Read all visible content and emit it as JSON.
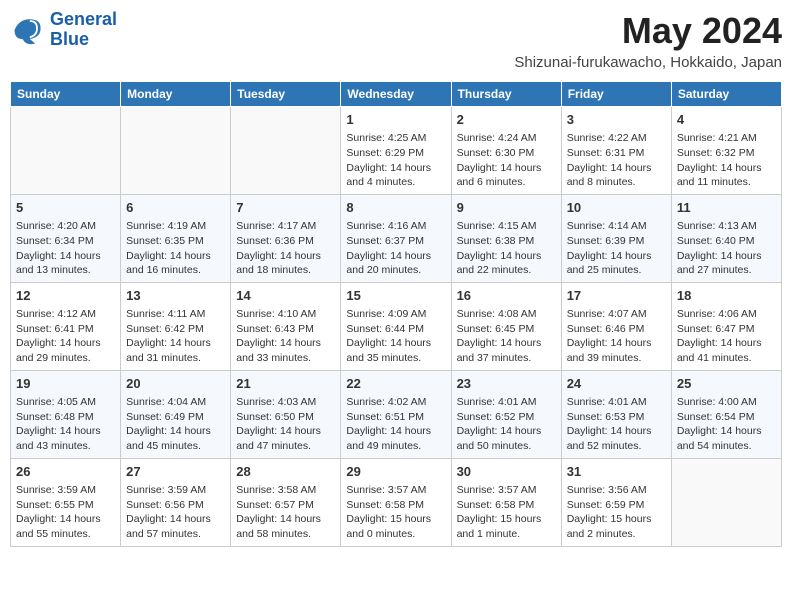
{
  "logo": {
    "line1": "General",
    "line2": "Blue"
  },
  "title": "May 2024",
  "location": "Shizunai-furukawacho, Hokkaido, Japan",
  "headers": [
    "Sunday",
    "Monday",
    "Tuesday",
    "Wednesday",
    "Thursday",
    "Friday",
    "Saturday"
  ],
  "weeks": [
    [
      {
        "day": "",
        "info": ""
      },
      {
        "day": "",
        "info": ""
      },
      {
        "day": "",
        "info": ""
      },
      {
        "day": "1",
        "info": "Sunrise: 4:25 AM\nSunset: 6:29 PM\nDaylight: 14 hours and 4 minutes."
      },
      {
        "day": "2",
        "info": "Sunrise: 4:24 AM\nSunset: 6:30 PM\nDaylight: 14 hours and 6 minutes."
      },
      {
        "day": "3",
        "info": "Sunrise: 4:22 AM\nSunset: 6:31 PM\nDaylight: 14 hours and 8 minutes."
      },
      {
        "day": "4",
        "info": "Sunrise: 4:21 AM\nSunset: 6:32 PM\nDaylight: 14 hours and 11 minutes."
      }
    ],
    [
      {
        "day": "5",
        "info": "Sunrise: 4:20 AM\nSunset: 6:34 PM\nDaylight: 14 hours and 13 minutes."
      },
      {
        "day": "6",
        "info": "Sunrise: 4:19 AM\nSunset: 6:35 PM\nDaylight: 14 hours and 16 minutes."
      },
      {
        "day": "7",
        "info": "Sunrise: 4:17 AM\nSunset: 6:36 PM\nDaylight: 14 hours and 18 minutes."
      },
      {
        "day": "8",
        "info": "Sunrise: 4:16 AM\nSunset: 6:37 PM\nDaylight: 14 hours and 20 minutes."
      },
      {
        "day": "9",
        "info": "Sunrise: 4:15 AM\nSunset: 6:38 PM\nDaylight: 14 hours and 22 minutes."
      },
      {
        "day": "10",
        "info": "Sunrise: 4:14 AM\nSunset: 6:39 PM\nDaylight: 14 hours and 25 minutes."
      },
      {
        "day": "11",
        "info": "Sunrise: 4:13 AM\nSunset: 6:40 PM\nDaylight: 14 hours and 27 minutes."
      }
    ],
    [
      {
        "day": "12",
        "info": "Sunrise: 4:12 AM\nSunset: 6:41 PM\nDaylight: 14 hours and 29 minutes."
      },
      {
        "day": "13",
        "info": "Sunrise: 4:11 AM\nSunset: 6:42 PM\nDaylight: 14 hours and 31 minutes."
      },
      {
        "day": "14",
        "info": "Sunrise: 4:10 AM\nSunset: 6:43 PM\nDaylight: 14 hours and 33 minutes."
      },
      {
        "day": "15",
        "info": "Sunrise: 4:09 AM\nSunset: 6:44 PM\nDaylight: 14 hours and 35 minutes."
      },
      {
        "day": "16",
        "info": "Sunrise: 4:08 AM\nSunset: 6:45 PM\nDaylight: 14 hours and 37 minutes."
      },
      {
        "day": "17",
        "info": "Sunrise: 4:07 AM\nSunset: 6:46 PM\nDaylight: 14 hours and 39 minutes."
      },
      {
        "day": "18",
        "info": "Sunrise: 4:06 AM\nSunset: 6:47 PM\nDaylight: 14 hours and 41 minutes."
      }
    ],
    [
      {
        "day": "19",
        "info": "Sunrise: 4:05 AM\nSunset: 6:48 PM\nDaylight: 14 hours and 43 minutes."
      },
      {
        "day": "20",
        "info": "Sunrise: 4:04 AM\nSunset: 6:49 PM\nDaylight: 14 hours and 45 minutes."
      },
      {
        "day": "21",
        "info": "Sunrise: 4:03 AM\nSunset: 6:50 PM\nDaylight: 14 hours and 47 minutes."
      },
      {
        "day": "22",
        "info": "Sunrise: 4:02 AM\nSunset: 6:51 PM\nDaylight: 14 hours and 49 minutes."
      },
      {
        "day": "23",
        "info": "Sunrise: 4:01 AM\nSunset: 6:52 PM\nDaylight: 14 hours and 50 minutes."
      },
      {
        "day": "24",
        "info": "Sunrise: 4:01 AM\nSunset: 6:53 PM\nDaylight: 14 hours and 52 minutes."
      },
      {
        "day": "25",
        "info": "Sunrise: 4:00 AM\nSunset: 6:54 PM\nDaylight: 14 hours and 54 minutes."
      }
    ],
    [
      {
        "day": "26",
        "info": "Sunrise: 3:59 AM\nSunset: 6:55 PM\nDaylight: 14 hours and 55 minutes."
      },
      {
        "day": "27",
        "info": "Sunrise: 3:59 AM\nSunset: 6:56 PM\nDaylight: 14 hours and 57 minutes."
      },
      {
        "day": "28",
        "info": "Sunrise: 3:58 AM\nSunset: 6:57 PM\nDaylight: 14 hours and 58 minutes."
      },
      {
        "day": "29",
        "info": "Sunrise: 3:57 AM\nSunset: 6:58 PM\nDaylight: 15 hours and 0 minutes."
      },
      {
        "day": "30",
        "info": "Sunrise: 3:57 AM\nSunset: 6:58 PM\nDaylight: 15 hours and 1 minute."
      },
      {
        "day": "31",
        "info": "Sunrise: 3:56 AM\nSunset: 6:59 PM\nDaylight: 15 hours and 2 minutes."
      },
      {
        "day": "",
        "info": ""
      }
    ]
  ]
}
